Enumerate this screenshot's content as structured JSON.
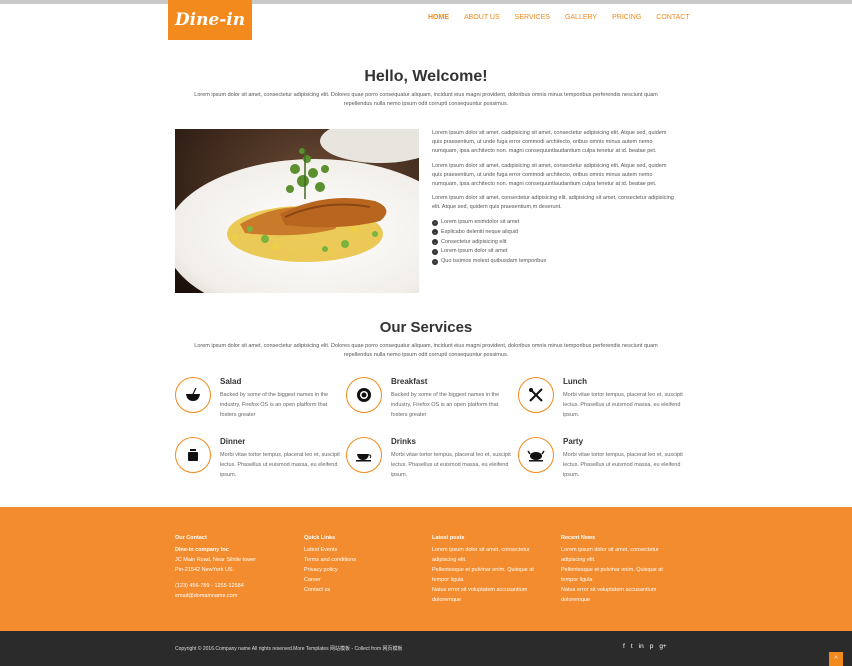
{
  "brand": {
    "logo_text": "Dine-in",
    "accent_color": "#f28a1e",
    "footer_color": "#f28c2e"
  },
  "nav": {
    "items": [
      {
        "label": "HOME",
        "active": true
      },
      {
        "label": "ABOUT US",
        "active": false
      },
      {
        "label": "SERVICES",
        "active": false
      },
      {
        "label": "GALLERY",
        "active": false
      },
      {
        "label": "PRICING",
        "active": false
      },
      {
        "label": "CONTACT",
        "active": false
      }
    ]
  },
  "welcome": {
    "title": "Hello, Welcome!",
    "subtitle": "Lorem ipsum dolor sit amet, consectetur adipisicing elit. Dolores quae porro consequatur aliquam, incidunt eius magni provident, doloribus omnis minus temporibus perferendis nesciunt quam repellendus nulla nemo ipsum odit corrupti consequuntur possimus."
  },
  "about": {
    "paragraphs": [
      "Lorem ipsum dolor sit amet, cadipisicing sit amet, consectetur adipisicing elit. Atque sed, quidem quis praesentium, ut unde fuga error commodi architecto, oribus omnis minus autem nemo numquam, ipsa architecto non. magni consequuntlaudantium culpa tenetur at id. beatae pet.",
      "Lorem ipsum dolor sit amet, cadipisicing sit amet, consectetur adipisicing elit. Atque sed, quidem quis praesentium, ut unde fuga error commodi architecto, oribus omnis minus autem nemo numquam, ipsa architecto non. magni consequuntlaudantium culpa tenetur at id. beatae pet.",
      "Lorem ipsum dolor sit amet, consectetur adipisicing elit. adipisicing sit amet, consectetur adipisicing elit. Atque sed, quidem quis praesentium,m deserunt."
    ],
    "list": [
      "Lorem ipsum enimdolor sit amet",
      "Explicabo deleniti neque aliquid",
      "Consectetur adipisicing elit",
      "Lorem ipsum dolor sit amet",
      "Quo issimos molest quibusdam temporibus"
    ]
  },
  "services": {
    "title": "Our Services",
    "subtitle": "Lorem ipsum dolor sit amet, consectetur adipisicing elit. Dolores quae porro consequatur aliquam, incidunt eius magni provident, doloribus omnis minus temporibus perferendis nesciunt quam repellendus nulla nemo ipsum odit corrupti consequuntur possimus.",
    "items": [
      {
        "title": "Salad",
        "text": "Backed by some of the biggest names in the industry, Firefox OS is an open platform that fosters greater",
        "icon": "salad-icon"
      },
      {
        "title": "Breakfast",
        "text": "Backed by some of the biggest names in the industry, Firefox OS is an open platform that fosters greater",
        "icon": "plate-icon"
      },
      {
        "title": "Lunch",
        "text": "Morbi vitae tortor tempus, placerat leo et, suscipit lectus. Phasellus ut euismod massa, eu eleifend ipsum.",
        "icon": "cutlery-icon"
      },
      {
        "title": "Dinner",
        "text": "Morbi vitae tortor tempus, placerat leo et, suscipit lectus. Phasellus ut euismod massa, eu eleifend ipsum.",
        "icon": "pot-icon"
      },
      {
        "title": "Drinks",
        "text": "Morbi vitae tortor tempus, placerat leo et, suscipit lectus. Phasellus ut euismod massa, eu eleifend ipsum.",
        "icon": "cup-icon"
      },
      {
        "title": "Party",
        "text": "Morbi vitae tortor tempus, placerat leo et, suscipit lectus. Phasellus ut euismod massa, eu eleifend ipsum.",
        "icon": "turkey-icon"
      }
    ]
  },
  "footer": {
    "contact": {
      "heading": "Our Contact",
      "company": "Dine-in company Inc",
      "address1": "JC Main Road, Near Silnile tower",
      "address2": "Pin-21542 NewYork US.",
      "phone": "(123) 456-789 - 1255-12584",
      "email": "email@domainname.com"
    },
    "quick_links": {
      "heading": "Quick Links",
      "links": [
        "Latest Events",
        "Terms and conditions",
        "Privacy policy",
        "Career",
        "Contact us"
      ]
    },
    "latest_posts": {
      "heading": "Latest posts",
      "posts": [
        "Lorem ipsum dolor sit amet, consectetur adipiscing elit.",
        "Pellentesque et pulvinar enim. Quisque at tempor ligula",
        "Natus error sit voluptatem accusantium doloremque"
      ]
    },
    "recent_news": {
      "heading": "Recent News",
      "posts": [
        "Lorem ipsum dolor sit amet, consectetur adipiscing elit.",
        "Pellentesque et pulvinar enim. Quisque at tempor ligula",
        "Natus error sit voluptatem accusantium doloremque"
      ]
    }
  },
  "bottom": {
    "copyright": "Copyright © 2016.Company name All rights reserved.More Templates 网站模板 - Collect from 网页模板",
    "social": [
      "f",
      "t",
      "in",
      "p",
      "g+"
    ],
    "to_top": "^"
  }
}
